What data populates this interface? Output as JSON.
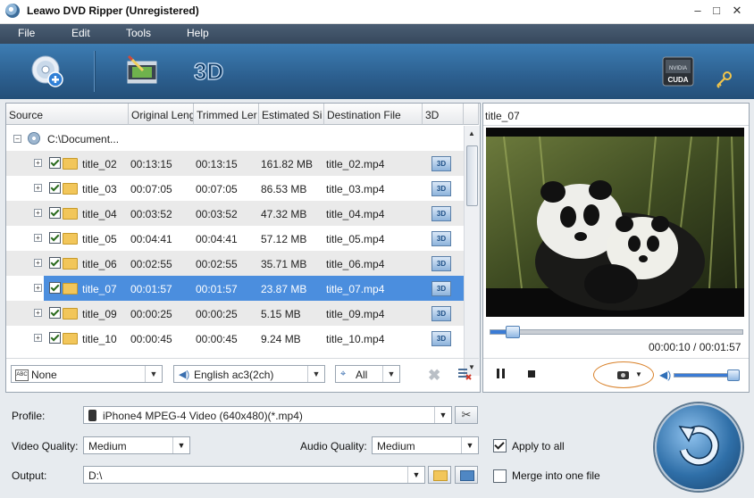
{
  "window": {
    "title": "Leawo DVD Ripper (Unregistered)",
    "min": "–",
    "max": "□",
    "close": "✕"
  },
  "menu": [
    "File",
    "Edit",
    "Tools",
    "Help"
  ],
  "toolbar": {
    "icons": [
      "add-dvd-icon",
      "edit-video-icon",
      "3d-icon",
      "cuda-icon",
      "settings-key-icon"
    ],
    "three_d_label": "3D",
    "cuda_label": "CUDA",
    "nvidia_label": "NVIDIA"
  },
  "list": {
    "columns": [
      "Source",
      "Original Leng",
      "Trimmed Ler",
      "Estimated Si",
      "Destination File",
      "3D"
    ],
    "root": "C:\\Document...",
    "rows": [
      {
        "name": "title_02",
        "original": "00:13:15",
        "trimmed": "00:13:15",
        "size": "161.82 MB",
        "dest": "title_02.mp4",
        "selected": false
      },
      {
        "name": "title_03",
        "original": "00:07:05",
        "trimmed": "00:07:05",
        "size": "86.53 MB",
        "dest": "title_03.mp4",
        "selected": false
      },
      {
        "name": "title_04",
        "original": "00:03:52",
        "trimmed": "00:03:52",
        "size": "47.32 MB",
        "dest": "title_04.mp4",
        "selected": false
      },
      {
        "name": "title_05",
        "original": "00:04:41",
        "trimmed": "00:04:41",
        "size": "57.12 MB",
        "dest": "title_05.mp4",
        "selected": false
      },
      {
        "name": "title_06",
        "original": "00:02:55",
        "trimmed": "00:02:55",
        "size": "35.71 MB",
        "dest": "title_06.mp4",
        "selected": false
      },
      {
        "name": "title_07",
        "original": "00:01:57",
        "trimmed": "00:01:57",
        "size": "23.87 MB",
        "dest": "title_07.mp4",
        "selected": true
      },
      {
        "name": "title_09",
        "original": "00:00:25",
        "trimmed": "00:00:25",
        "size": "5.15 MB",
        "dest": "title_09.mp4",
        "selected": false
      },
      {
        "name": "title_10",
        "original": "00:00:45",
        "trimmed": "00:00:45",
        "size": "9.24 MB",
        "dest": "title_10.mp4",
        "selected": false
      }
    ],
    "three_d_button": "3D"
  },
  "tracks": {
    "subtitle": "None",
    "audio": "English ac3(2ch)",
    "angle": "All"
  },
  "preview": {
    "title": "title_07",
    "time": "00:00:10 / 00:01:57",
    "progress_fraction": 0.085,
    "volume_fraction": 0.9
  },
  "bottom": {
    "profile_label": "Profile:",
    "profile_value": "iPhone4 MPEG-4 Video (640x480)(*.mp4)",
    "video_quality_label": "Video Quality:",
    "video_quality_value": "Medium",
    "audio_quality_label": "Audio Quality:",
    "audio_quality_value": "Medium",
    "output_label": "Output:",
    "output_value": "D:\\",
    "apply_to_all": "Apply to all",
    "apply_to_all_checked": true,
    "merge_label": "Merge into one file",
    "merge_checked": false
  },
  "colors": {
    "toolbar": "#2c5f8f",
    "menubar": "#3f5165",
    "selection": "#4b8ede",
    "convert_button": "#2f6fa8"
  }
}
